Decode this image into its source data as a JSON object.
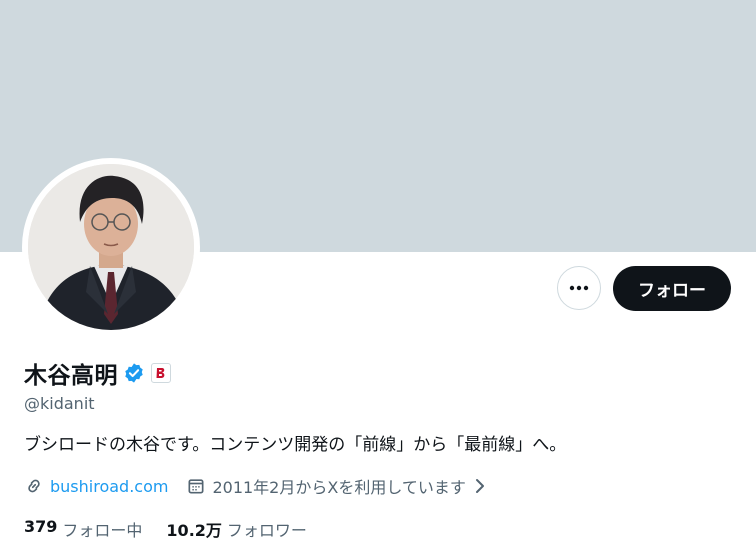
{
  "banner": {
    "color": "#cfd9de"
  },
  "profile": {
    "display_name": "木谷高明",
    "handle": "@kidanit",
    "bio": "ブシロードの木谷です。コンテンツ開発の「前線」から「最前線」へ。",
    "website": "bushiroad.com",
    "joined": "2011年2月からXを利用しています",
    "verified_icon": "verified-badge-icon",
    "affiliate_icon": "bushiroad-logo-icon"
  },
  "actions": {
    "more_icon": "more-dots-icon",
    "follow_label": "フォロー"
  },
  "stats": {
    "following_count": "379",
    "following_label": "フォロー中",
    "followers_count": "10.2万",
    "followers_label": "フォロワー"
  },
  "colors": {
    "accent": "#1d9bf0",
    "text": "#0f1419",
    "muted": "#536471",
    "button": "#0f1419"
  }
}
